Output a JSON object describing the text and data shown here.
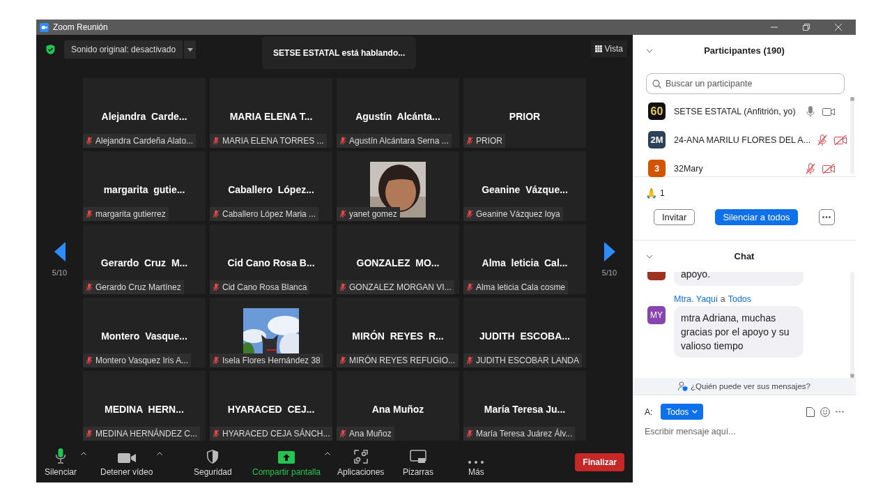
{
  "window": {
    "title": "Zoom Reunión"
  },
  "top_bar": {
    "original_sound": "Sonido original: desactivado",
    "speaker_banner": "SETSE ESTATAL está hablando...",
    "view": "Vista"
  },
  "pager": {
    "left": "5/10",
    "right": "5/10"
  },
  "tiles": [
    {
      "kind": "name",
      "display_name": "Alejandra  Carde...",
      "label": "Alejandra Cardeña Alato...",
      "muted": true
    },
    {
      "kind": "name",
      "display_name": "MARIA ELENA T...",
      "label": "MARIA ELENA TORRES ...",
      "muted": true
    },
    {
      "kind": "name",
      "display_name": "Agustín  Alcánta...",
      "label": "Agustín Alcántara Serna ...",
      "muted": true
    },
    {
      "kind": "name",
      "display_name": "PRIOR",
      "label": "PRIOR",
      "muted": true
    },
    {
      "kind": "name",
      "display_name": "margarita  gutie...",
      "label": "margarita gutierrez",
      "muted": true
    },
    {
      "kind": "name",
      "display_name": "Caballero  López...",
      "label": "Caballero López Maria ...",
      "muted": true
    },
    {
      "kind": "picture",
      "label": "yanet gomez",
      "muted": true
    },
    {
      "kind": "name",
      "display_name": "Geanine  Vázque...",
      "label": "Geanine Vázquez loya",
      "muted": true
    },
    {
      "kind": "name",
      "display_name": "Gerardo  Cruz  M...",
      "label": "Gerardo Cruz Martínez",
      "muted": true
    },
    {
      "kind": "name",
      "display_name": "Cid Cano Rosa B...",
      "label": "Cid Cano Rosa Blanca",
      "muted": true
    },
    {
      "kind": "name",
      "display_name": "GONZALEZ  MO...",
      "label": "GONZALEZ MORGAN VI...",
      "muted": true
    },
    {
      "kind": "name",
      "display_name": "Alma  leticia  Cal...",
      "label": "Alma leticia Cala cosme",
      "muted": true
    },
    {
      "kind": "name",
      "display_name": "Montero  Vasque...",
      "label": "Montero Vasquez Iris A...",
      "muted": true
    },
    {
      "kind": "picture",
      "label": "Isela Flores Hernández 38",
      "muted": true
    },
    {
      "kind": "name",
      "display_name": "MIRÓN  REYES  R...",
      "label": "MIRÓN REYES REFUGIO...",
      "muted": true
    },
    {
      "kind": "name",
      "display_name": "JUDITH  ESCOBA...",
      "label": "JUDITH ESCOBAR LANDA",
      "muted": true
    },
    {
      "kind": "name",
      "display_name": "MEDINA  HERN...",
      "label": "MEDINA HERNÁNDEZ C...",
      "muted": true
    },
    {
      "kind": "name",
      "display_name": "HYARACED  CEJ...",
      "label": "HYARACED CEJA SÁNCH...",
      "muted": true
    },
    {
      "kind": "name",
      "display_name": "Ana Muñoz",
      "label": "Ana Muñoz",
      "muted": true
    },
    {
      "kind": "name",
      "display_name": "María Teresa Ju...",
      "label": "María Teresa Juárez Álv...",
      "muted": true
    }
  ],
  "toolbar": [
    {
      "kind": "mic",
      "label": "Silenciar",
      "caret": true
    },
    {
      "kind": "video",
      "label": "Detener vídeo",
      "caret": true
    },
    {
      "kind": "security",
      "label": "Seguridad",
      "caret": false
    },
    {
      "kind": "share",
      "label": "Compartir pantalla",
      "caret": true
    },
    {
      "kind": "apps",
      "label": "Aplicaciones",
      "caret": false
    },
    {
      "kind": "whiteboard",
      "label": "Pizarras",
      "caret": false
    },
    {
      "kind": "more",
      "label": "Más",
      "caret": false
    }
  ],
  "end_button": "Finalizar",
  "participants": {
    "title": "Participantes (190)",
    "search": {
      "placeholder": "Buscar un participante"
    },
    "items": [
      {
        "avatar": "60",
        "color": "#111111",
        "name": "SETSE ESTATAL (Anfitrión, yo)",
        "muted": false,
        "video_off": false
      },
      {
        "avatar": "2M",
        "color": "#2d4256",
        "name": "24-ANA MARILU FLORES DEL A...",
        "muted": true,
        "video_off": true
      },
      {
        "avatar": "3",
        "color": "#d35400",
        "name": "32Mary",
        "muted": true,
        "video_off": true
      }
    ],
    "reaction_emoji": "🙏",
    "reaction_count": "1",
    "buttons": [
      "Invitar",
      "Silenciar a todos"
    ]
  },
  "chat": {
    "title": "Chat",
    "messages": [
      {
        "color": "#a03020",
        "text": "apoyo."
      },
      {
        "avatar": "MY",
        "color": "#8a44b0",
        "sender": "Mtra. Yaqui",
        "to_word": "a",
        "recipient": "Todos",
        "text": "mtra Adriana, muchas gracias por el apoyo y su valioso tiempo"
      }
    ],
    "privacy": "¿Quién puede ver sus mensajes?",
    "to_label": "A:",
    "to_value": "Todos",
    "input": {
      "placeholder": "Escribir mensaje aquí..."
    }
  }
}
